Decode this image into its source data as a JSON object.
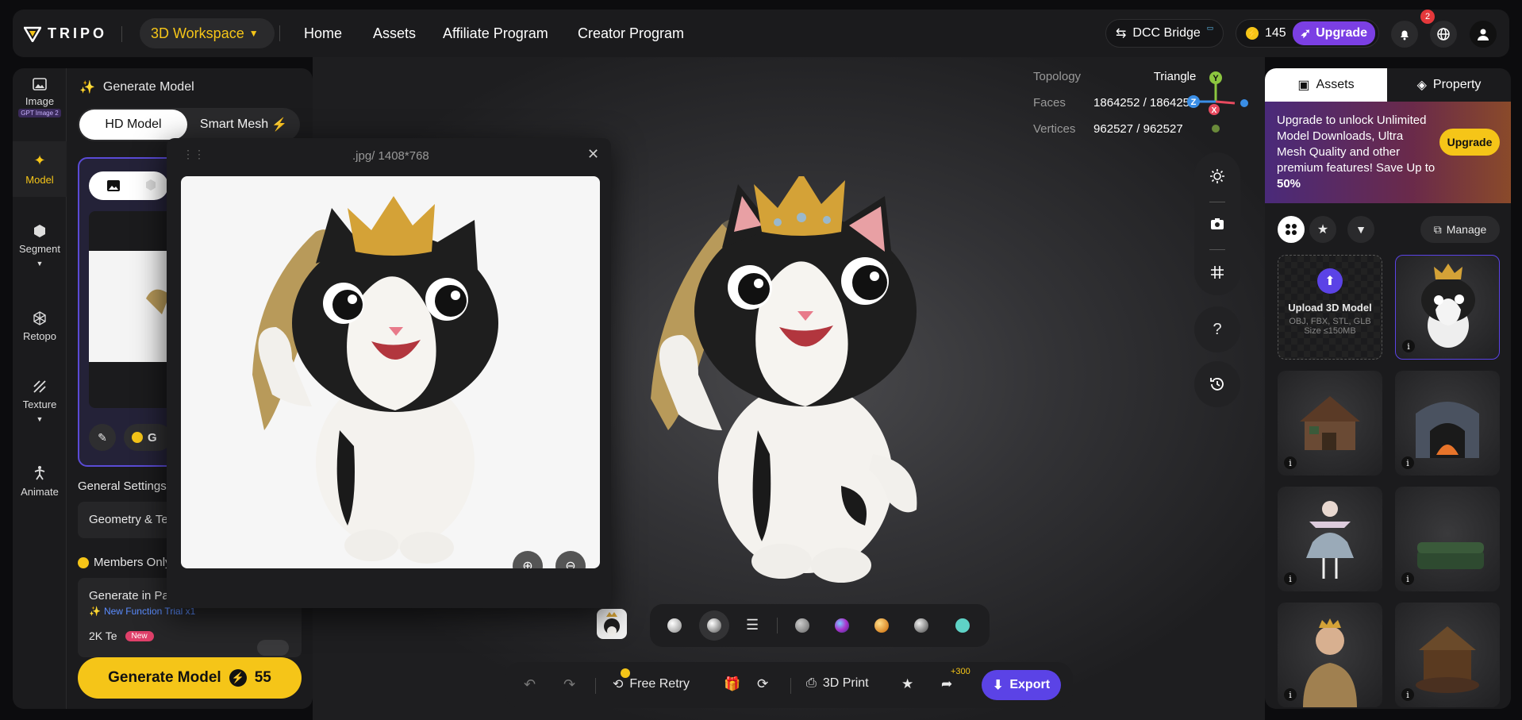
{
  "topbar": {
    "logo_text": "TRIPO",
    "workspace_label": "3D Workspace",
    "nav": [
      "Home",
      "Assets",
      "Affiliate Program",
      "Creator Program"
    ],
    "dcc_label": "DCC Bridge",
    "credits": "145",
    "upgrade_label": "Upgrade",
    "notification_count": "2"
  },
  "rail": {
    "items": [
      {
        "label": "Image",
        "badge": "GPT Image 2"
      },
      {
        "label": "Model"
      },
      {
        "label": "Segment"
      },
      {
        "label": "Retopo"
      },
      {
        "label": "Texture"
      },
      {
        "label": "Animate"
      }
    ]
  },
  "left_panel": {
    "title": "Generate Model",
    "tab_hd": "HD Model",
    "tab_smart": "Smart Mesh",
    "general_settings": "General Settings",
    "geometry_label": "Geometry & Te",
    "members_only": "Members Only",
    "generate_in_parts": "Generate in Par",
    "new_function_trial": "New Function Trial x1",
    "texture_4k": "2K Te",
    "new_badge": "New",
    "gen_partial": "G",
    "generate_button": "Generate Model",
    "generate_cost": "55"
  },
  "popup": {
    "title": ".jpg/ 1408*768"
  },
  "viewer": {
    "topology_label": "Topology",
    "topology_value": "Triangle",
    "faces_label": "Faces",
    "faces_value": "1864252 / 1864252",
    "vertices_label": "Vertices",
    "vertices_value": "962527 / 962527",
    "axis_y": "Y",
    "axis_z": "Z",
    "axis_x": "X"
  },
  "action_bar": {
    "free_retry": "Free Retry",
    "print_3d": "3D Print",
    "share_bonus": "+300",
    "export": "Export"
  },
  "right_panel": {
    "tab_assets": "Assets",
    "tab_property": "Property",
    "promo_text": "Upgrade to unlock Unlimited Model Downloads, Ultra Mesh Quality and other premium features!  Save Up to ",
    "promo_pct": "50%",
    "promo_button": "Upgrade",
    "manage": "Manage",
    "upload_title": "Upload 3D Model",
    "upload_formats": "OBJ, FBX, STL, GLB",
    "upload_size": "Size ≤150MB",
    "thumbnails": [
      "cat-with-crown",
      "cottage",
      "fireplace",
      "ballerina",
      "green-sofa",
      "queen-bust",
      "market-stall"
    ]
  },
  "colors": {
    "accent_yellow": "#f5c518",
    "accent_purple": "#5b43e6",
    "panel_bg": "#1b1b1d"
  }
}
